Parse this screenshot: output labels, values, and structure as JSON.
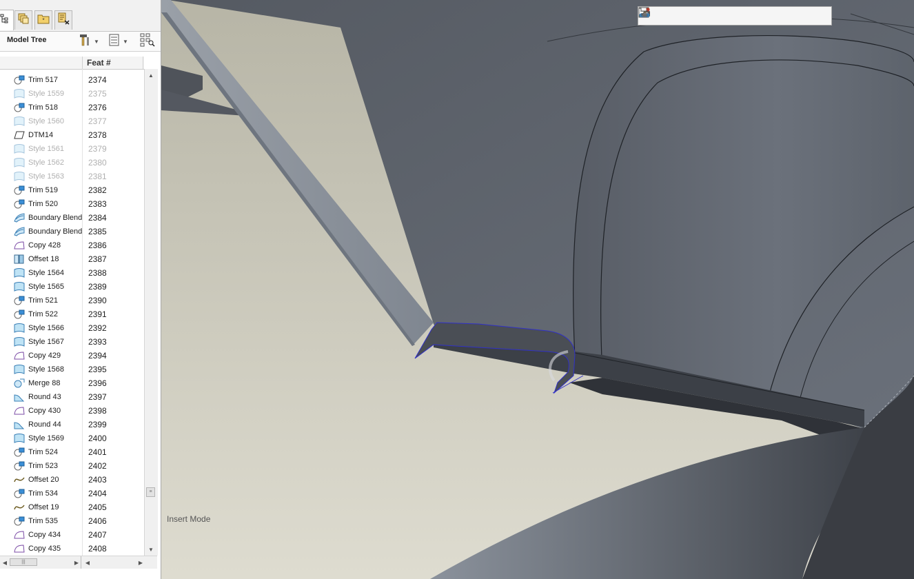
{
  "tabs": [
    {
      "icon": "model-tree-icon",
      "active": true
    },
    {
      "icon": "layers-icon"
    },
    {
      "icon": "folder-browser-icon"
    },
    {
      "icon": "favorites-icon"
    }
  ],
  "model_tree": {
    "title": "Model Tree",
    "settings_icon": "hammer-settings-icon",
    "show_icon": "list-show-icon",
    "filter_icon": "tree-filter-icon",
    "column_header": "Feat #",
    "rows": [
      {
        "name": "Trim 517",
        "feat": "2374",
        "icon": "trim-icon",
        "dim": false
      },
      {
        "name": "Style 1559",
        "feat": "2375",
        "icon": "style-icon",
        "dim": true
      },
      {
        "name": "Trim 518",
        "feat": "2376",
        "icon": "trim-icon",
        "dim": false
      },
      {
        "name": "Style 1560",
        "feat": "2377",
        "icon": "style-icon",
        "dim": true
      },
      {
        "name": "DTM14",
        "feat": "2378",
        "icon": "datum-plane-icon",
        "dim": false
      },
      {
        "name": "Style 1561",
        "feat": "2379",
        "icon": "style-icon",
        "dim": true
      },
      {
        "name": "Style 1562",
        "feat": "2380",
        "icon": "style-icon",
        "dim": true
      },
      {
        "name": "Style 1563",
        "feat": "2381",
        "icon": "style-icon",
        "dim": true
      },
      {
        "name": "Trim 519",
        "feat": "2382",
        "icon": "trim-icon",
        "dim": false
      },
      {
        "name": "Trim 520",
        "feat": "2383",
        "icon": "trim-icon",
        "dim": false
      },
      {
        "name": "Boundary Blend",
        "feat": "2384",
        "icon": "boundary-blend-icon",
        "dim": false
      },
      {
        "name": "Boundary Blend",
        "feat": "2385",
        "icon": "boundary-blend-icon",
        "dim": false
      },
      {
        "name": "Copy 428",
        "feat": "2386",
        "icon": "copy-icon",
        "dim": false
      },
      {
        "name": "Offset 18",
        "feat": "2387",
        "icon": "offset-surface-icon",
        "dim": false
      },
      {
        "name": "Style 1564",
        "feat": "2388",
        "icon": "style-icon",
        "dim": false
      },
      {
        "name": "Style 1565",
        "feat": "2389",
        "icon": "style-icon",
        "dim": false
      },
      {
        "name": "Trim 521",
        "feat": "2390",
        "icon": "trim-icon",
        "dim": false
      },
      {
        "name": "Trim 522",
        "feat": "2391",
        "icon": "trim-icon",
        "dim": false
      },
      {
        "name": "Style 1566",
        "feat": "2392",
        "icon": "style-icon",
        "dim": false
      },
      {
        "name": "Style 1567",
        "feat": "2393",
        "icon": "style-icon",
        "dim": false
      },
      {
        "name": "Copy 429",
        "feat": "2394",
        "icon": "copy-icon",
        "dim": false
      },
      {
        "name": "Style 1568",
        "feat": "2395",
        "icon": "style-icon",
        "dim": false
      },
      {
        "name": "Merge 88",
        "feat": "2396",
        "icon": "merge-icon",
        "dim": false
      },
      {
        "name": "Round 43",
        "feat": "2397",
        "icon": "round-icon",
        "dim": false
      },
      {
        "name": "Copy 430",
        "feat": "2398",
        "icon": "copy-icon",
        "dim": false
      },
      {
        "name": "Round 44",
        "feat": "2399",
        "icon": "round-icon",
        "dim": false
      },
      {
        "name": "Style 1569",
        "feat": "2400",
        "icon": "style-icon",
        "dim": false
      },
      {
        "name": "Trim 524",
        "feat": "2401",
        "icon": "trim-icon",
        "dim": false
      },
      {
        "name": "Trim 523",
        "feat": "2402",
        "icon": "trim-icon",
        "dim": false
      },
      {
        "name": "Offset 20",
        "feat": "2403",
        "icon": "offset-curve-icon",
        "dim": false
      },
      {
        "name": "Trim 534",
        "feat": "2404",
        "icon": "trim-icon",
        "dim": false
      },
      {
        "name": "Offset 19",
        "feat": "2405",
        "icon": "offset-curve-icon",
        "dim": false
      },
      {
        "name": "Trim 535",
        "feat": "2406",
        "icon": "trim-icon",
        "dim": false
      },
      {
        "name": "Copy 434",
        "feat": "2407",
        "icon": "copy-icon",
        "dim": false
      },
      {
        "name": "Copy 435",
        "feat": "2408",
        "icon": "copy-icon",
        "dim": false
      }
    ]
  },
  "view_toolbar": [
    {
      "icon": "refit-icon"
    },
    {
      "icon": "zoom-in-icon"
    },
    {
      "icon": "zoom-out-icon"
    },
    {
      "icon": "repaint-icon"
    },
    {
      "icon": "display-style-icon"
    },
    {
      "icon": "saved-views-icon"
    },
    {
      "icon": "view-manager-icon"
    },
    {
      "icon": "datum-display-icon"
    },
    {
      "icon": "annotation-display-icon"
    },
    {
      "icon": "spin-center-icon"
    }
  ],
  "status": {
    "mode": "Insert Mode"
  },
  "colors": {
    "surface_dark": "#5b6068",
    "surface_light": "#8b929c",
    "background": "#d8d8c8",
    "highlight": "#3030c8"
  }
}
